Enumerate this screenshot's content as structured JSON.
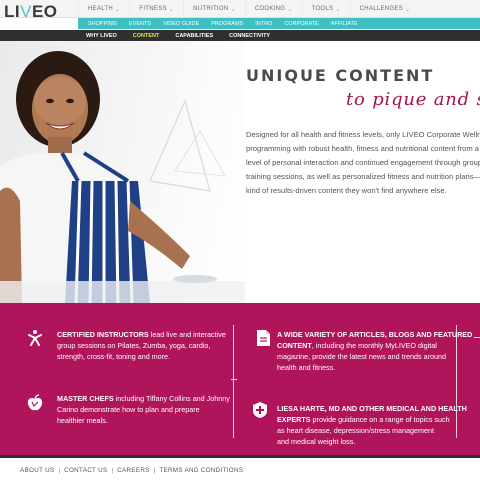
{
  "logo": {
    "text_before": "LI",
    "mark": "V",
    "text_after": "EO",
    "icon": "liveo-logo"
  },
  "topnav": [
    {
      "label": "HEALTH",
      "caret": "⌄"
    },
    {
      "label": "FITNESS",
      "caret": "⌄"
    },
    {
      "label": "NUTRITION",
      "caret": "⌄"
    },
    {
      "label": "COOKING",
      "caret": "⌄"
    },
    {
      "label": "TOOLS",
      "caret": "⌄"
    },
    {
      "label": "CHALLENGES",
      "caret": "⌄"
    }
  ],
  "subnav": [
    "SHOPPING",
    "EVENTS",
    "VIDEO GUIDE",
    "PROGRAMS",
    "INTRO",
    "CORPORATE",
    "AFFILIATE"
  ],
  "darknav": [
    {
      "label": "WHY LIVEO",
      "active": false
    },
    {
      "label": "CONTENT",
      "active": true
    },
    {
      "label": "CAPABILITIES",
      "active": false
    },
    {
      "label": "CONNECTIVITY",
      "active": false
    }
  ],
  "colors": {
    "teal": "#3dbfc3",
    "magenta": "#b0155b",
    "active_nav": "#e4e44a",
    "dark": "#2f2f2f"
  },
  "hero": {
    "heading": "UNIQUE CONTENT",
    "subheading": "to pique and s",
    "intro_lines": [
      "Designed for all health and fitness levels, only LIVEO Corporate Wellnes",
      "programming with robust health, fitness and nutritional content from a",
      "level of personal interaction and continued engagement through group",
      "training sessions, as well as personalized fitness and nutrition plans—p",
      "kind of results-driven content they won't find anywhere else."
    ]
  },
  "features": [
    {
      "icon": "fitness-figure-icon",
      "bold": "CERTIFIED INSTRUCTORS",
      "lines": [
        " lead live and interactive",
        "group sessions on Pilates, Zumba, yoga, cardio,",
        "strength, cross-fit, toning and more."
      ]
    },
    {
      "icon": "article-document-icon",
      "bold_lines": [
        "A WIDE VARIETY OF ARTICLES, BLOGS AND FEATURED",
        "CONTENT"
      ],
      "lines": [
        ", including the monthly MyLIVEO digital",
        "magazine, provide the latest news and trends around",
        "health and fitness."
      ]
    },
    {
      "icon": "apple-icon",
      "bold": "MASTER CHEFS",
      "lines": [
        " including Tiffany Collins and Johnny",
        "Carino demonstrate how to plan and prepare",
        "healthier meals."
      ]
    },
    {
      "icon": "medical-badge-icon",
      "bold_lines": [
        "LIESA HARTE, MD AND OTHER MEDICAL AND HEALTH",
        "EXPERTS"
      ],
      "lines": [
        " provide guidance on a range of topics such",
        "as heart disease, depression/stress management",
        "and medical weight loss."
      ]
    }
  ],
  "footer": [
    "ABOUT US",
    "CONTACT US",
    "CAREERS",
    "TERMS AND CONDITIONS"
  ],
  "footer_separator": "|"
}
